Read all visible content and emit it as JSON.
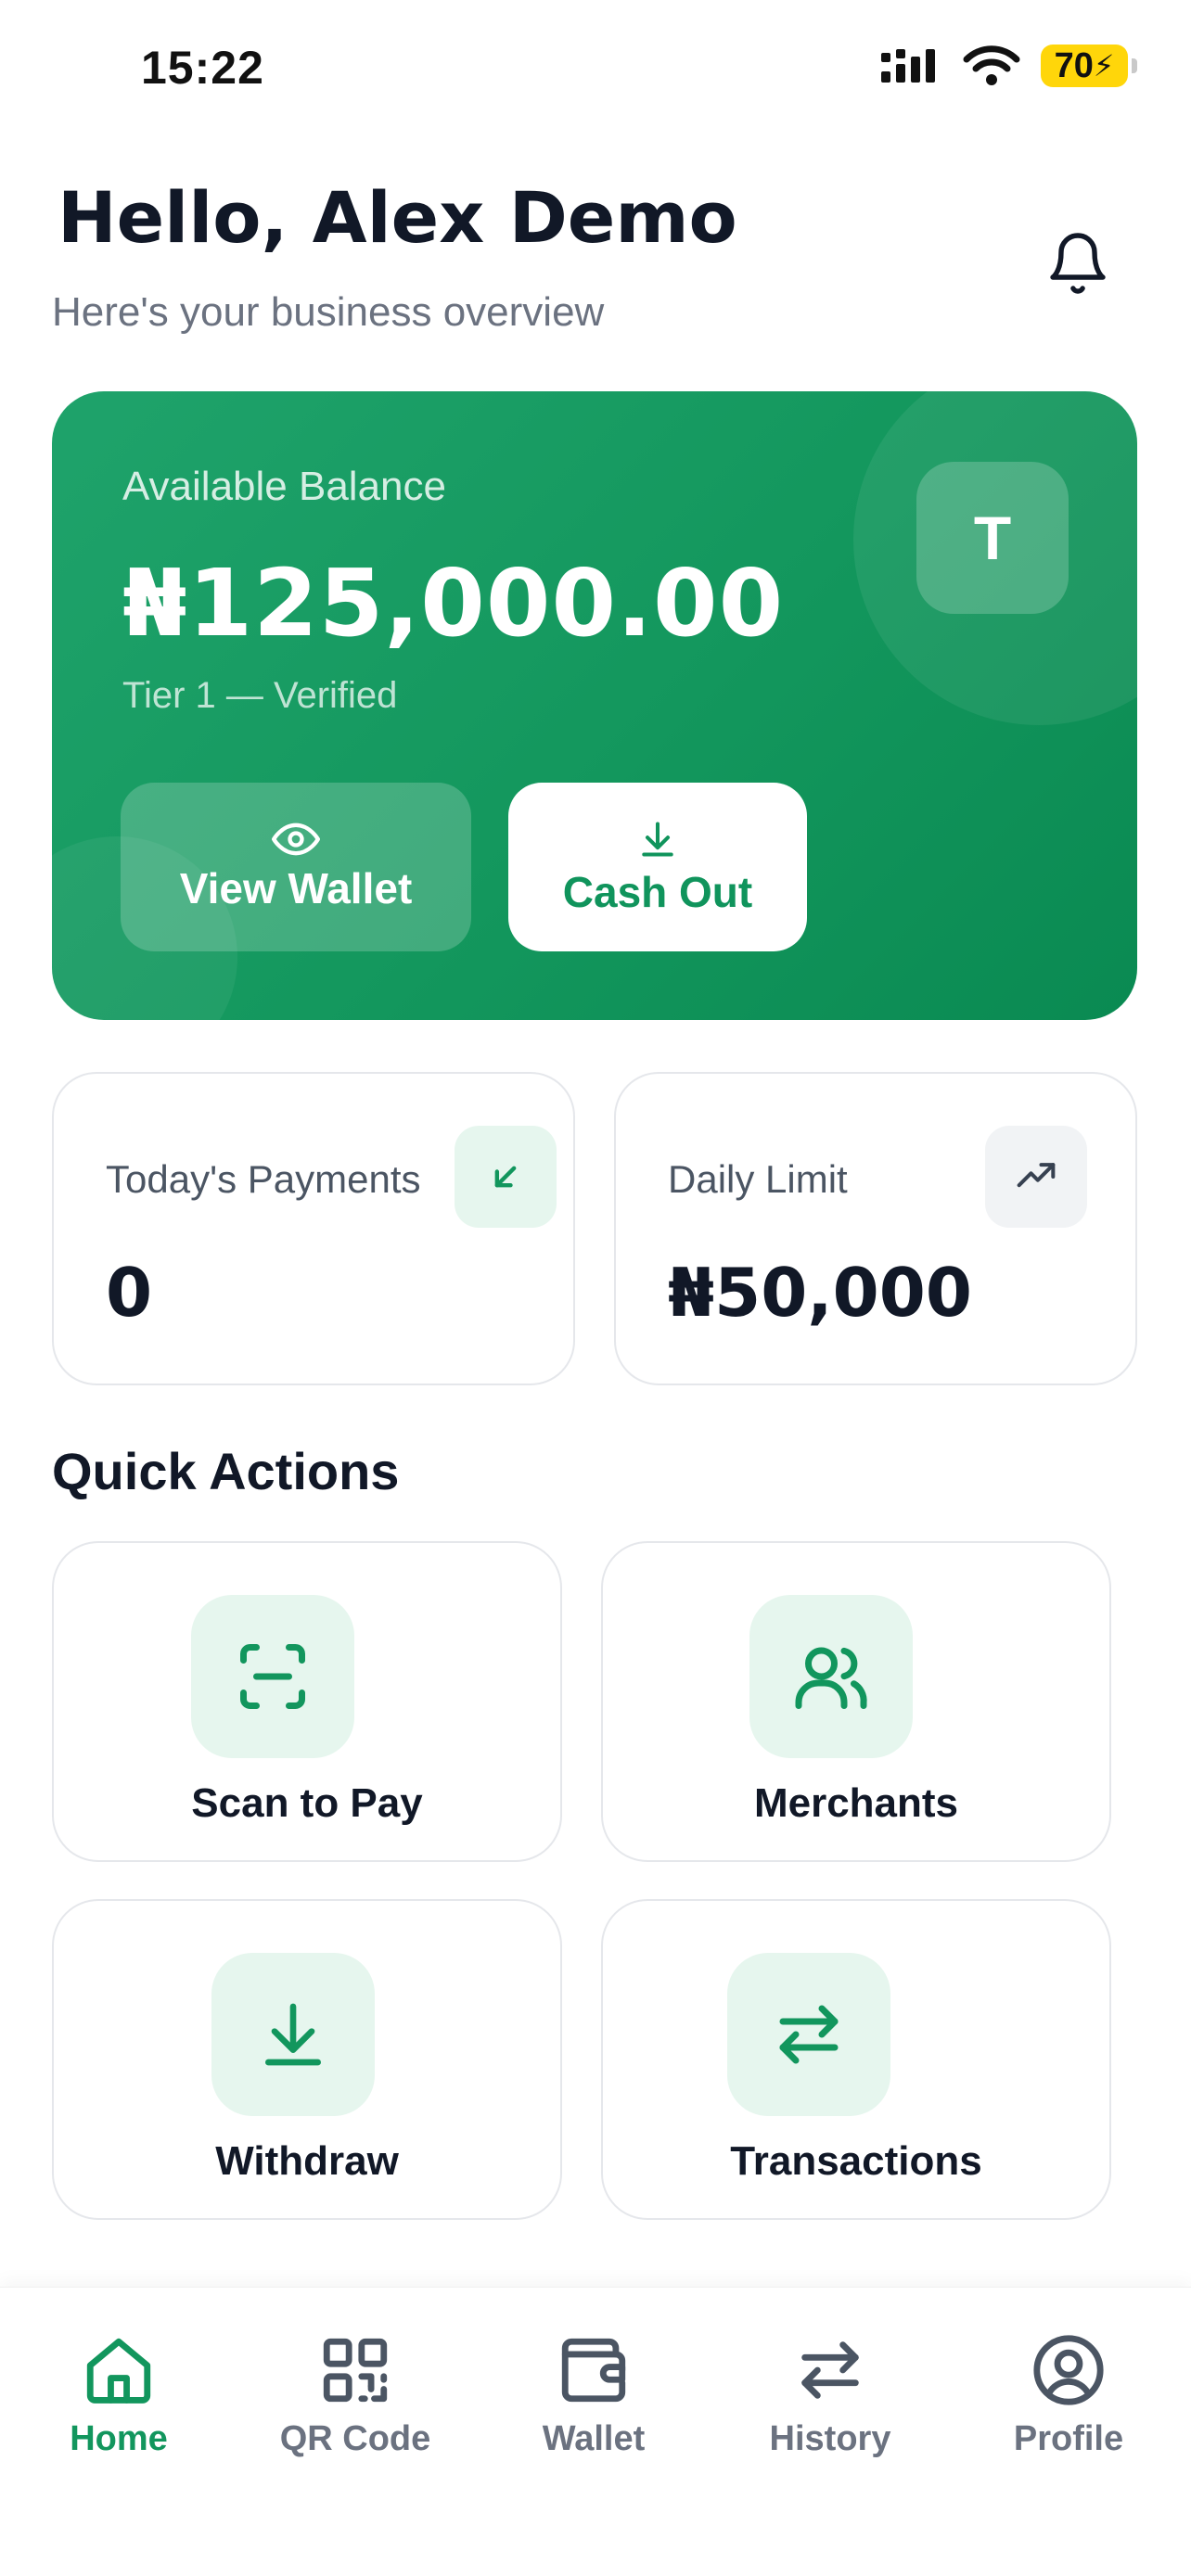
{
  "status_bar": {
    "time": "15:22",
    "battery": "70"
  },
  "header": {
    "greeting": "Hello, Alex Demo",
    "subtitle": "Here's your business overview"
  },
  "balance_card": {
    "label": "Available Balance",
    "amount": "₦125,000.00",
    "tier": "Tier 1 — Verified",
    "avatar_initial": "T",
    "view_wallet_label": "View Wallet",
    "cash_out_label": "Cash Out"
  },
  "stats": {
    "payments": {
      "label": "Today's Payments",
      "value": "0",
      "icon": "arrow-down-left-icon"
    },
    "limit": {
      "label": "Daily Limit",
      "value": "₦50,000",
      "icon": "trending-up-icon"
    }
  },
  "quick_actions": {
    "title": "Quick Actions",
    "items": [
      {
        "label": "Scan to Pay",
        "icon": "scan-icon"
      },
      {
        "label": "Merchants",
        "icon": "users-icon"
      },
      {
        "label": "Withdraw",
        "icon": "download-icon"
      },
      {
        "label": "Transactions",
        "icon": "arrows-left-right-icon"
      }
    ]
  },
  "bottom_nav": {
    "items": [
      {
        "label": "Home",
        "icon": "home-icon",
        "active": true
      },
      {
        "label": "QR Code",
        "icon": "qr-code-icon"
      },
      {
        "label": "Wallet",
        "icon": "wallet-icon"
      },
      {
        "label": "History",
        "icon": "arrows-left-right-icon"
      },
      {
        "label": "Profile",
        "icon": "user-circle-icon"
      }
    ]
  },
  "colors": {
    "brand_green": "#13975d",
    "icon_bg_green": "#e6f6ee",
    "text_primary": "#111827",
    "text_secondary": "#6b7280",
    "battery_yellow": "#ffd60a"
  }
}
